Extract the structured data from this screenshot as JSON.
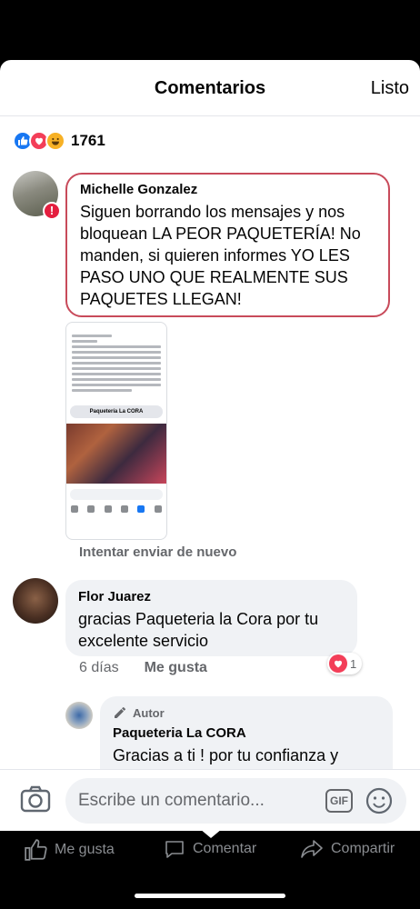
{
  "header": {
    "title": "Comentarios",
    "done_label": "Listo"
  },
  "reactions": {
    "count": "1761",
    "types": [
      "like",
      "love",
      "haha"
    ]
  },
  "comments": [
    {
      "author": "Michelle Gonzalez",
      "text": "Siguen borrando los mensajes y nos bloquean LA PEOR PAQUETERÍA! No manden, si quieren informes YO LES PASO UNO QUE REALMENTE SUS PAQUETES LLEGAN!",
      "status": "error",
      "attachment": {
        "page_name": "Paquetería La CORA"
      },
      "retry_label": "Intentar enviar de nuevo"
    },
    {
      "author": "Flor Juarez",
      "text": "gracias Paqueteria la Cora por tu excelente servicio",
      "time": "6 días",
      "like_label": "Me gusta",
      "reaction_count": "1"
    },
    {
      "author_tag": "Autor",
      "author": "Paqueteria La CORA",
      "text": "Gracias a ti ! por tu confianza y"
    }
  ],
  "composer": {
    "placeholder": "Escribe un comentario...",
    "gif_label": "GIF"
  },
  "actions": {
    "like": "Me gusta",
    "comment": "Comentar",
    "share": "Compartir"
  },
  "colors": {
    "accent": "#1877f2",
    "error": "#e41e3f",
    "bubble": "#f0f2f5"
  }
}
